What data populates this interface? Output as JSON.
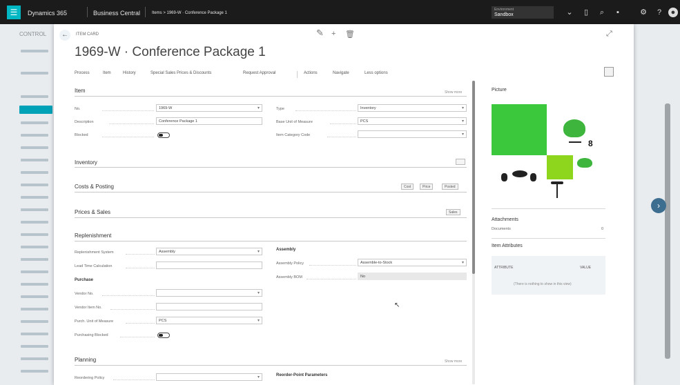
{
  "topbar": {
    "product": "Dynamics 365",
    "app": "Business Central",
    "breadcrumb": "Items > 1969-W · Conference Package 1",
    "env_label": "Environment",
    "env_value": "Sandbox"
  },
  "background_list": {
    "heading": "CONTROL"
  },
  "card": {
    "item_card_label": "ITEM CARD",
    "title": "1969-W · Conference Package 1",
    "actions": [
      "Process",
      "Item",
      "History",
      "Special Sales Prices & Discounts",
      "Request Approval",
      "Actions",
      "Navigate",
      "Less options"
    ]
  },
  "sections": {
    "item": {
      "title": "Item",
      "show_more": "Show more",
      "no_label": "No.",
      "no_value": "1969-W",
      "description_label": "Description",
      "description_value": "Conference Package 1",
      "blocked_label": "Blocked",
      "type_label": "Type",
      "type_value": "Inventory",
      "base_uom_label": "Base Unit of Measure",
      "base_uom_value": "PCS",
      "item_category_label": "Item Category Code",
      "item_category_value": ""
    },
    "inventory": {
      "title": "Inventory"
    },
    "costs": {
      "title": "Costs & Posting",
      "btn1": "Cost",
      "btn2": "Price",
      "btn3": "Posted"
    },
    "prices": {
      "title": "Prices & Sales",
      "btn": "Sales"
    },
    "replenishment": {
      "title": "Replenishment",
      "system_label": "Replenishment System",
      "system_value": "Assembly",
      "lead_time_label": "Lead Time Calculation",
      "lead_time_value": "",
      "purchase_head": "Purchase",
      "vendor_no_label": "Vendor No.",
      "vendor_item_label": "Vendor Item No.",
      "purch_uom_label": "Purch. Unit of Measure",
      "purch_uom_value": "PCS",
      "purch_blocked_label": "Purchasing Blocked",
      "assembly_head": "Assembly",
      "assembly_policy_label": "Assembly Policy",
      "assembly_policy_value": "Assemble-to-Stock",
      "assembly_bom_label": "Assembly BOM",
      "assembly_bom_value": "No"
    },
    "planning": {
      "title": "Planning",
      "show_more": "Show more",
      "reordering_label": "Reordering Policy",
      "order_modifiers_head": "Reorder-Point Parameters"
    }
  },
  "factbox": {
    "picture_title": "Picture",
    "attachments_title": "Attachments",
    "documents_label": "Documents",
    "documents_value": "0",
    "attributes_title": "Item Attributes",
    "attr_col1": "ATTRIBUTE",
    "attr_col2": "VALUE",
    "attr_empty": "(There is nothing to show in this view)"
  }
}
